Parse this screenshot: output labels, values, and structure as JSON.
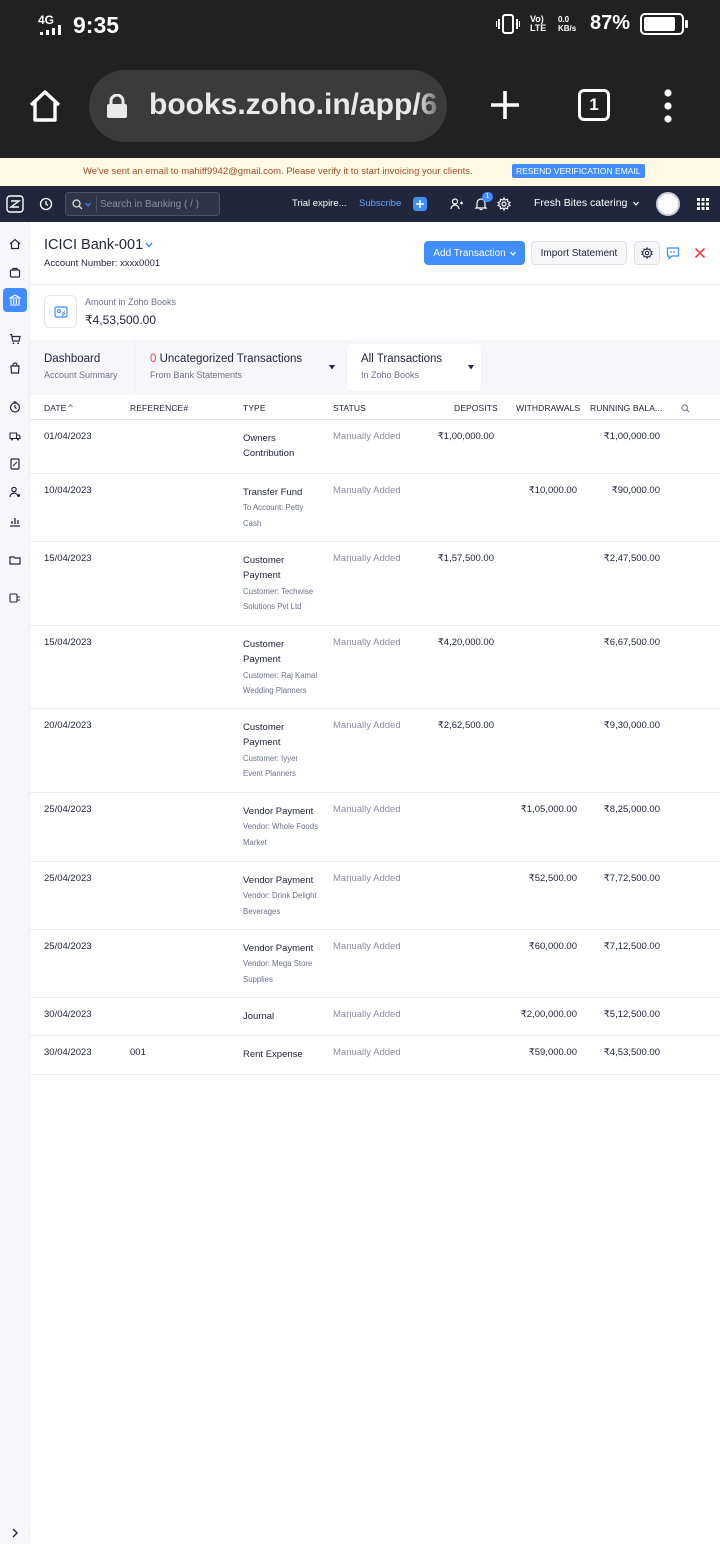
{
  "status_bar": {
    "network": "4G",
    "time": "9:35",
    "battery_percent": "87%",
    "battery_level": 0.87,
    "lte_label": "Vo) LTE",
    "data_speed": "0.0 KB/s"
  },
  "browser": {
    "url": "books.zoho.in/app/6",
    "tab_count": "1"
  },
  "banner": {
    "message": "We've sent an email to mahiff9942@gmail.com. Please verify it to start invoicing your clients.",
    "button": "RESEND VERIFICATION EMAIL"
  },
  "topnav": {
    "search_placeholder": "Search in Banking ( / )",
    "trial_text": "Trial expire...",
    "subscribe": "Subscribe",
    "notification_count": "1",
    "org_name": "Fresh Bites catering"
  },
  "account": {
    "name": "ICICI Bank-001",
    "number": "Account Number: xxxx0001",
    "amount_label": "Amount in Zoho Books",
    "amount": "₹4,53,500.00"
  },
  "actions": {
    "add_transaction": "Add Transaction",
    "import_statement": "Import Statement"
  },
  "tabs": {
    "dashboard_title": "Dashboard",
    "dashboard_sub": "Account Summary",
    "uncat_count": "0",
    "uncat_title": "Uncategorized Transactions",
    "uncat_sub": "From Bank Statements",
    "all_title": "All Transactions",
    "all_sub": "In Zoho Books"
  },
  "table": {
    "headers": {
      "date": "DATE",
      "reference": "REFERENCE#",
      "type": "TYPE",
      "status": "STATUS",
      "deposits": "DEPOSITS",
      "withdrawals": "WITHDRAWALS",
      "running": "RUNNING BALA..."
    },
    "rows": [
      {
        "date": "01/04/2023",
        "ref": "",
        "type_l1": "Owners",
        "type_l2": "Contribution",
        "sub_l1": "",
        "sub_l2": "",
        "status": "Manually Added",
        "deposit": "₹1,00,000.00",
        "withdrawal": "",
        "balance": "₹1,00,000.00"
      },
      {
        "date": "10/04/2023",
        "ref": "",
        "type_l1": "Transfer Fund",
        "type_l2": "",
        "sub_l1": "To Account: Petty",
        "sub_l2": "Cash",
        "status": "Manually Added",
        "deposit": "",
        "withdrawal": "₹10,000.00",
        "balance": "₹90,000.00"
      },
      {
        "date": "15/04/2023",
        "ref": "",
        "type_l1": "Customer",
        "type_l2": "Payment",
        "sub_l1": "Customer: Techwise",
        "sub_l2": "Solutions Pvt Ltd",
        "status": "Manually Added",
        "deposit": "₹1,57,500.00",
        "withdrawal": "",
        "balance": "₹2,47,500.00"
      },
      {
        "date": "15/04/2023",
        "ref": "",
        "type_l1": "Customer",
        "type_l2": "Payment",
        "sub_l1": "Customer: Raj Kamal",
        "sub_l2": "Wedding Planners",
        "status": "Manually Added",
        "deposit": "₹4,20,000.00",
        "withdrawal": "",
        "balance": "₹6,67,500.00"
      },
      {
        "date": "20/04/2023",
        "ref": "",
        "type_l1": "Customer",
        "type_l2": "Payment",
        "sub_l1": "Customer: Iyyer",
        "sub_l2": "Event Planners",
        "status": "Manually Added",
        "deposit": "₹2,62,500.00",
        "withdrawal": "",
        "balance": "₹9,30,000.00"
      },
      {
        "date": "25/04/2023",
        "ref": "",
        "type_l1": "Vendor Payment",
        "type_l2": "",
        "sub_l1": "Vendor: Whole Foods",
        "sub_l2": "Market",
        "status": "Manually Added",
        "deposit": "",
        "withdrawal": "₹1,05,000.00",
        "balance": "₹8,25,000.00"
      },
      {
        "date": "25/04/2023",
        "ref": "",
        "type_l1": "Vendor Payment",
        "type_l2": "",
        "sub_l1": "Vendor: Drink Delight",
        "sub_l2": "Beverages",
        "status": "Manually Added",
        "deposit": "",
        "withdrawal": "₹52,500.00",
        "balance": "₹7,72,500.00"
      },
      {
        "date": "25/04/2023",
        "ref": "",
        "type_l1": "Vendor Payment",
        "type_l2": "",
        "sub_l1": "Vendor: Mega Store",
        "sub_l2": "Supplies",
        "status": "Manually Added",
        "deposit": "",
        "withdrawal": "₹60,000.00",
        "balance": "₹7,12,500.00"
      },
      {
        "date": "30/04/2023",
        "ref": "",
        "type_l1": "Journal",
        "type_l2": "",
        "sub_l1": "",
        "sub_l2": "",
        "status": "Manually Added",
        "deposit": "",
        "withdrawal": "₹2,00,000.00",
        "balance": "₹5,12,500.00"
      },
      {
        "date": "30/04/2023",
        "ref": "001",
        "type_l1": "Rent Expense",
        "type_l2": "",
        "sub_l1": "",
        "sub_l2": "",
        "status": "Manually Added",
        "deposit": "",
        "withdrawal": "₹59,000.00",
        "balance": "₹4,53,500.00"
      }
    ]
  },
  "colors": {
    "accent": "#408dfb",
    "nav_bg": "#21263c",
    "banner_bg": "#fdf9e4",
    "close_red": "#e3474b"
  }
}
